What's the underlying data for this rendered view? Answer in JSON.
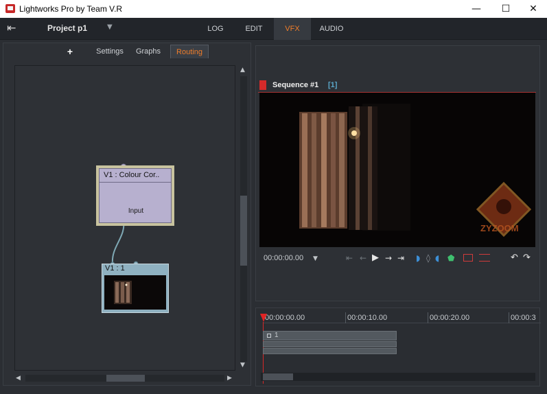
{
  "window": {
    "title": "Lightworks Pro by Team V.R",
    "minimize_glyph": "—",
    "maximize_glyph": "☐",
    "close_glyph": "✕"
  },
  "header": {
    "exit_icon": "⇤",
    "project_name": "Project p1",
    "project_dropdown_arrow": "▼",
    "tabs": [
      {
        "label": "LOG",
        "active": false
      },
      {
        "label": "EDIT",
        "active": false
      },
      {
        "label": "VFX",
        "active": true
      },
      {
        "label": "AUDIO",
        "active": false
      }
    ],
    "accent_color": "#f07d2a"
  },
  "vfx_panel": {
    "add_label": "+",
    "tabs": [
      {
        "label": "Settings",
        "active": false
      },
      {
        "label": "Graphs",
        "active": false
      },
      {
        "label": "Routing",
        "active": true
      }
    ],
    "nodes": [
      {
        "title": "V1 : Colour Cor..",
        "port_label": "Input"
      },
      {
        "title": "V1 : 1"
      }
    ]
  },
  "viewer": {
    "sequence_title": "Sequence #1",
    "sequence_index": "[1]",
    "timecode": "00:00:00.00",
    "watermark_text": "ZYZOOM",
    "transport_icons": [
      "go-to-start-icon",
      "step-back-icon",
      "play-icon",
      "step-forward-icon",
      "go-to-end-icon",
      "mark-in-icon",
      "mark-clear-icon",
      "mark-out-icon",
      "marker-icon",
      "lift-icon",
      "replace-icon",
      "undo-icon",
      "redo-icon"
    ]
  },
  "timeline": {
    "ruler": [
      "00:00:00.00",
      "00:00:10.00",
      "00:00:20.00",
      "00:00:3"
    ],
    "track_label": "1"
  }
}
